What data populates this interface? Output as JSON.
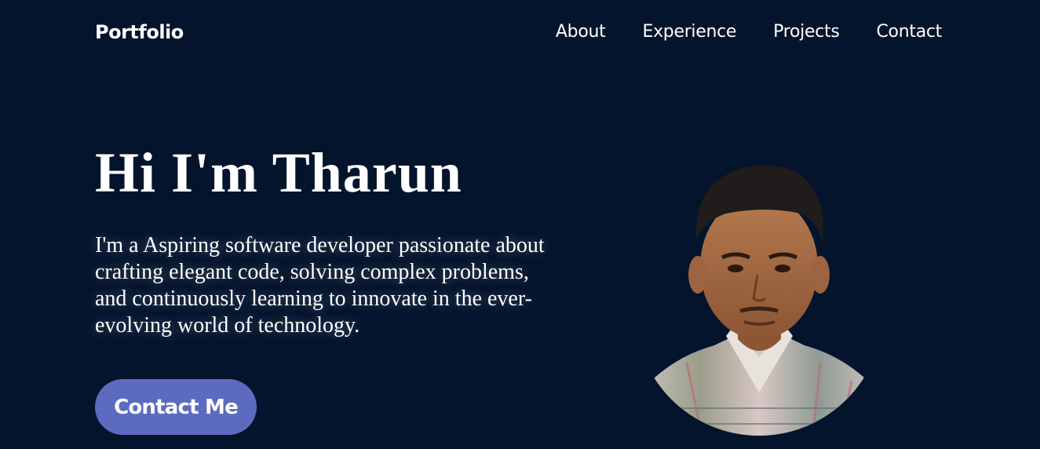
{
  "brand": {
    "name": "Portfolio"
  },
  "nav": {
    "items": [
      {
        "label": "About"
      },
      {
        "label": "Experience"
      },
      {
        "label": "Projects"
      },
      {
        "label": "Contact"
      }
    ]
  },
  "hero": {
    "title": "Hi I'm Tharun",
    "description": "I'm a Aspiring software developer passionate about crafting elegant code, solving complex problems, and continuously learning to innovate in the ever-evolving world of technology.",
    "cta_label": "Contact Me"
  },
  "profile": {
    "icon": "profile-photo"
  },
  "colors": {
    "background": "#04142d",
    "accent": "#5c6bbf",
    "text": "#ffffff"
  }
}
